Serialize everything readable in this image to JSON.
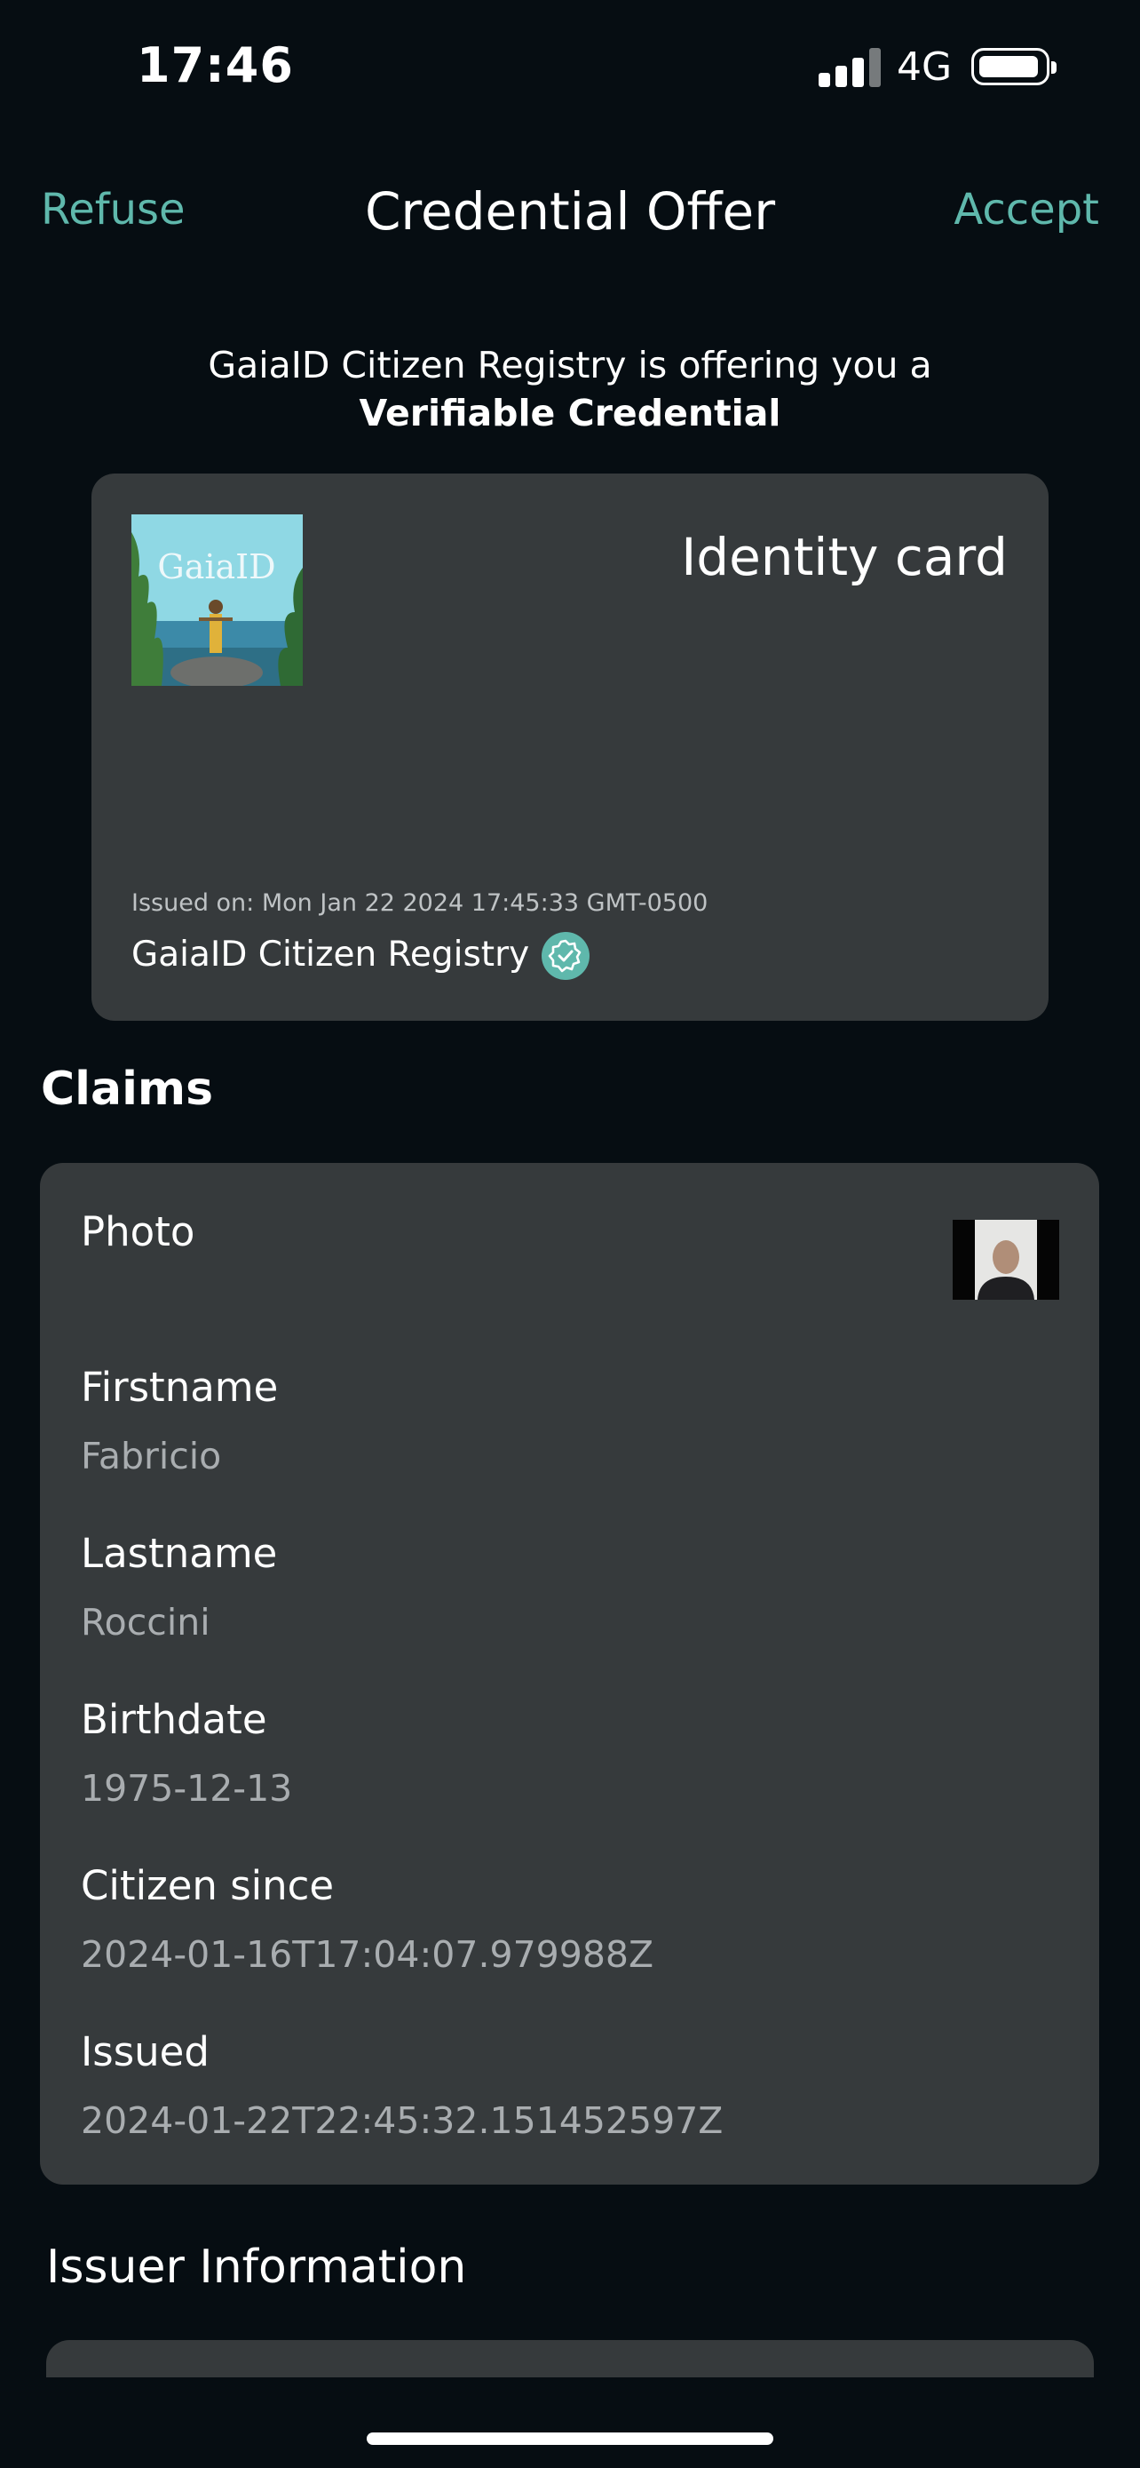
{
  "status_bar": {
    "time": "17:46",
    "network": "4G",
    "signal_bars": 4,
    "battery_level": 1.0
  },
  "header": {
    "refuse_label": "Refuse",
    "title": "Credential Offer",
    "accept_label": "Accept"
  },
  "offer": {
    "line1": "GaiaID Citizen Registry is offering you a",
    "line2": "Verifiable Credential"
  },
  "credential_card": {
    "logo_text": "GaiaID",
    "title": "Identity card",
    "issued_on": "Issued on: Mon Jan 22 2024 17:45:33 GMT-0500",
    "issuer": "GaiaID Citizen Registry",
    "verified_icon": "verified-badge-icon"
  },
  "claims": {
    "title": "Claims",
    "photo_label": "Photo",
    "items": [
      {
        "label": "Firstname",
        "value": "Fabricio"
      },
      {
        "label": "Lastname",
        "value": "Roccini"
      },
      {
        "label": "Birthdate",
        "value": "1975-12-13"
      },
      {
        "label": "Citizen since",
        "value": "2024-01-16T17:04:07.979988Z"
      },
      {
        "label": "Issued",
        "value": "2024-01-22T22:45:32.151452597Z"
      }
    ]
  },
  "issuer_information": {
    "title": "Issuer Information"
  },
  "colors": {
    "background": "#060d12",
    "card": "#363a3c",
    "accent": "#5fb8ac"
  }
}
